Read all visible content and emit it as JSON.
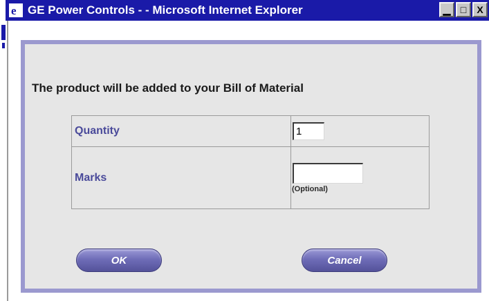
{
  "window": {
    "title": "GE Power Controls - - Microsoft Internet Explorer",
    "minimize_glyph": "▁",
    "maximize_glyph": "□",
    "close_glyph": "X",
    "accent_color": "#1a1aa8"
  },
  "dialog": {
    "heading": "The product will be added to your Bill of Material",
    "frame_color": "#9b99cf",
    "background_color": "#e6e6e6",
    "quantity_label": "Quantity",
    "quantity_value": "1",
    "marks_label": "Marks",
    "marks_value": "",
    "marks_note": "(Optional)",
    "ok_label": "OK",
    "cancel_label": "Cancel",
    "button_color": "#6f6db8"
  },
  "icons": {
    "app": "internet-explorer-icon"
  }
}
